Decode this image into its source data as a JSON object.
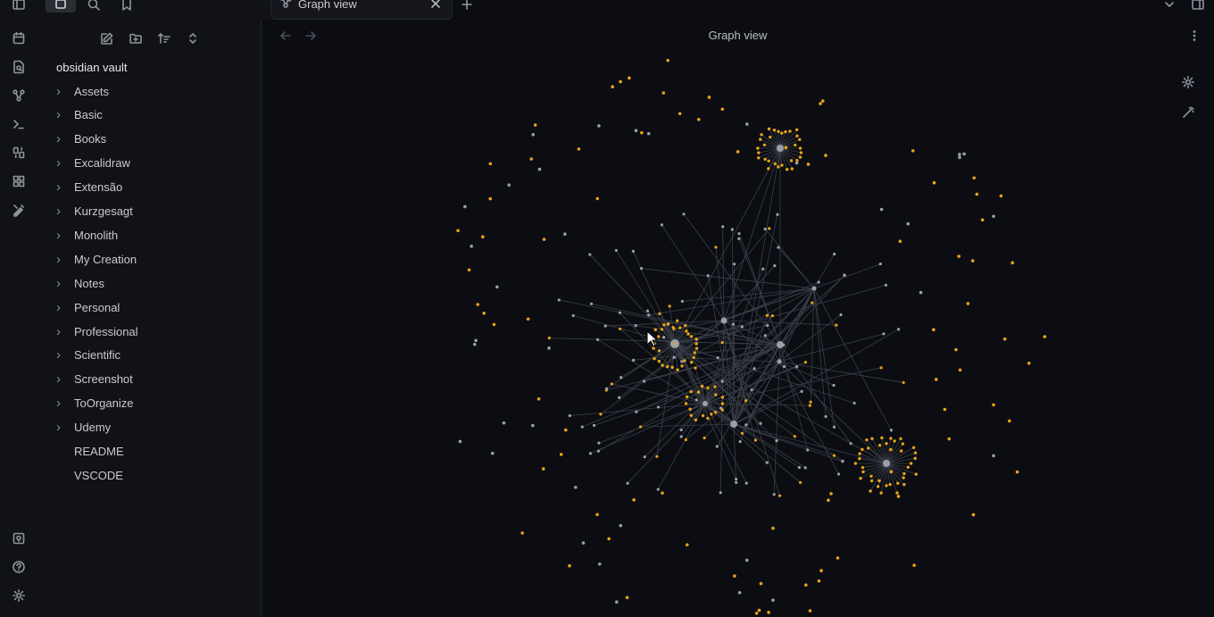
{
  "tab": {
    "title": "Graph view"
  },
  "main": {
    "view_title": "Graph view"
  },
  "sidebar": {
    "vault_name": "obsidian vault",
    "items": [
      {
        "label": "Assets",
        "folder": true
      },
      {
        "label": "Basic",
        "folder": true
      },
      {
        "label": "Books",
        "folder": true
      },
      {
        "label": "Excalidraw",
        "folder": true
      },
      {
        "label": "Extensão",
        "folder": true
      },
      {
        "label": "Kurzgesagt",
        "folder": true
      },
      {
        "label": "Monolith",
        "folder": true
      },
      {
        "label": "My Creation",
        "folder": true
      },
      {
        "label": "Notes",
        "folder": true
      },
      {
        "label": "Personal",
        "folder": true
      },
      {
        "label": "Professional",
        "folder": true
      },
      {
        "label": "Scientific",
        "folder": true
      },
      {
        "label": "Screenshot",
        "folder": true
      },
      {
        "label": "ToOrganize",
        "folder": true
      },
      {
        "label": "Udemy",
        "folder": true
      },
      {
        "label": "README",
        "folder": false
      },
      {
        "label": "VSCODE",
        "folder": false
      }
    ]
  },
  "icons": {
    "ribbon_top": [
      "calendar-icon",
      "file-search-icon",
      "graph-icon",
      "terminal-icon",
      "dice-icon",
      "blocks-icon",
      "excalidraw-icon"
    ],
    "ribbon_bottom": [
      "vault-icon",
      "help-icon",
      "settings-icon"
    ],
    "toolbar": [
      "new-note-icon",
      "new-folder-icon",
      "sort-icon",
      "collapse-icon"
    ],
    "graph_controls": [
      "graph-settings-icon",
      "magic-wand-icon"
    ]
  },
  "colors": {
    "background": "#0b0d12",
    "sidebar": "#101216",
    "node_note": "#9aa0a8",
    "node_attachment": "#e8a317",
    "edge": "#3b3f48"
  }
}
